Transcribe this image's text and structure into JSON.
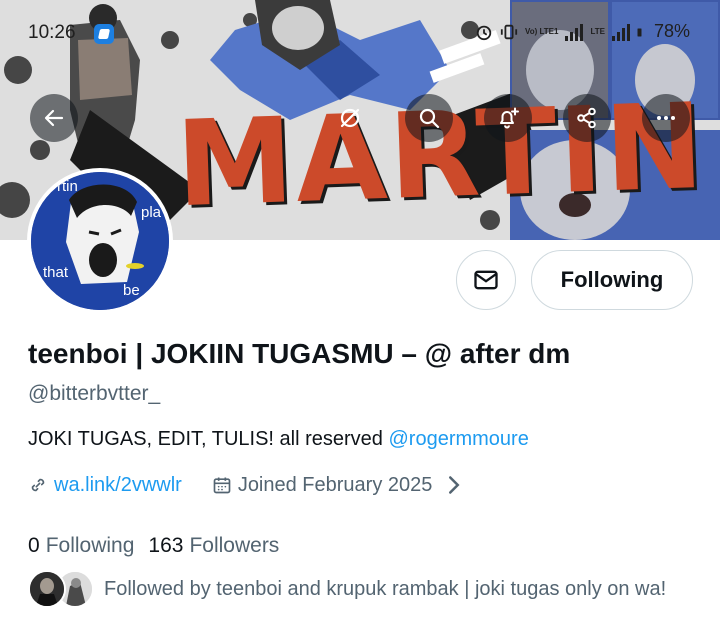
{
  "status_bar": {
    "time": "10:26",
    "battery": "78%",
    "network_label_top": "LTE",
    "network_label_left": "Vo) LTE1"
  },
  "banner": {
    "word": "MARTIN",
    "accent_color": "#cc4a2a"
  },
  "header_actions": [
    {
      "name": "back",
      "icon": "arrow-left-icon"
    },
    {
      "name": "grok",
      "icon": "grok-icon"
    },
    {
      "name": "search",
      "icon": "search-icon"
    },
    {
      "name": "notify",
      "icon": "bell-plus-icon"
    },
    {
      "name": "share",
      "icon": "share-icon"
    },
    {
      "name": "more",
      "icon": "more-icon"
    }
  ],
  "avatar": {
    "words": [
      "rtin",
      "pla",
      "that",
      "be"
    ]
  },
  "profile": {
    "display_name": "teenboi | JOKIIN TUGASMU – @ after dm",
    "handle": "@bitterbvtter_",
    "bio_text": "JOKI TUGAS, EDIT, TULIS! all reserved ",
    "bio_mention": "@rogermmoure",
    "link": "wa.link/2vwwlr",
    "joined": "Joined February 2025"
  },
  "actions": {
    "follow_label": "Following",
    "message_icon": "mail-icon"
  },
  "counts": {
    "following_value": "0",
    "following_label": "Following",
    "followers_value": "163",
    "followers_label": "Followers"
  },
  "followed_by": {
    "text": "Followed by teenboi and krupuk rambak | joki tugas only on wa!"
  },
  "colors": {
    "link_blue": "#1d9bf0",
    "secondary_text": "#536471",
    "primary_text": "#0f1419",
    "border": "#cfd9de"
  }
}
